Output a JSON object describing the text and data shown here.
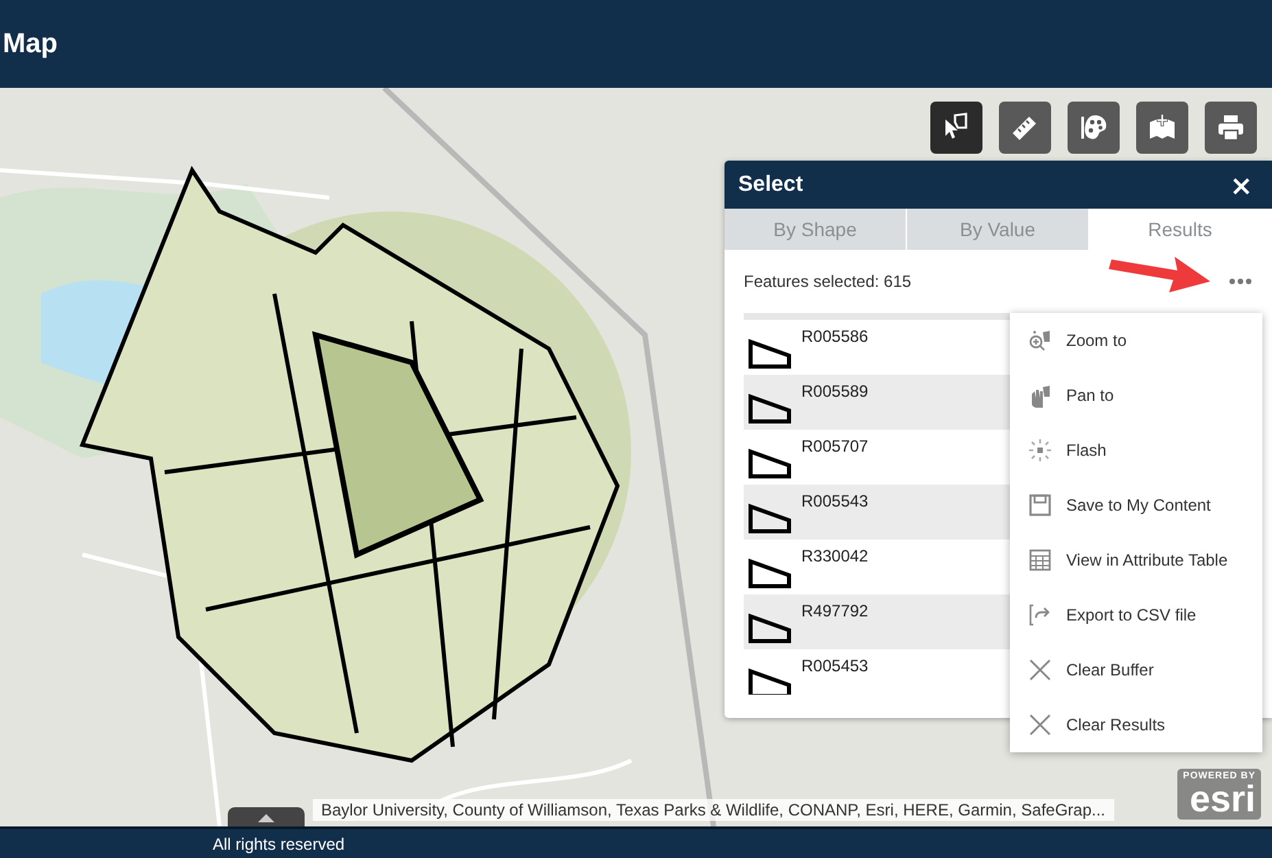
{
  "header": {
    "title": "Map"
  },
  "toolbar": [
    {
      "selected": true
    },
    {
      "selected": false
    },
    {
      "selected": false
    },
    {
      "selected": false
    },
    {
      "selected": false
    }
  ],
  "select_panel": {
    "title": "Select",
    "close": "×",
    "tabs": [
      {
        "label": "By Shape",
        "selected": false
      },
      {
        "label": "By Value",
        "selected": false
      },
      {
        "label": "Results",
        "selected": true
      }
    ],
    "summary": "Features selected: 615",
    "rows": [
      "R005586",
      "R005589",
      "R005707",
      "R005543",
      "R330042",
      "R497792",
      "R005453"
    ],
    "menu": [
      "Zoom to",
      "Pan to",
      "Flash",
      "Save to My Content",
      "View in Attribute Table",
      "Export to CSV file",
      "Clear Buffer",
      "Clear Results"
    ]
  },
  "attribution": "Baylor University, County of Williamson, Texas Parks & Wildlife, CONANP, Esri, HERE, Garmin, SafeGrap...",
  "logo": {
    "caption": "POWERED BY",
    "name": "esri"
  },
  "footer": "All rights reserved"
}
